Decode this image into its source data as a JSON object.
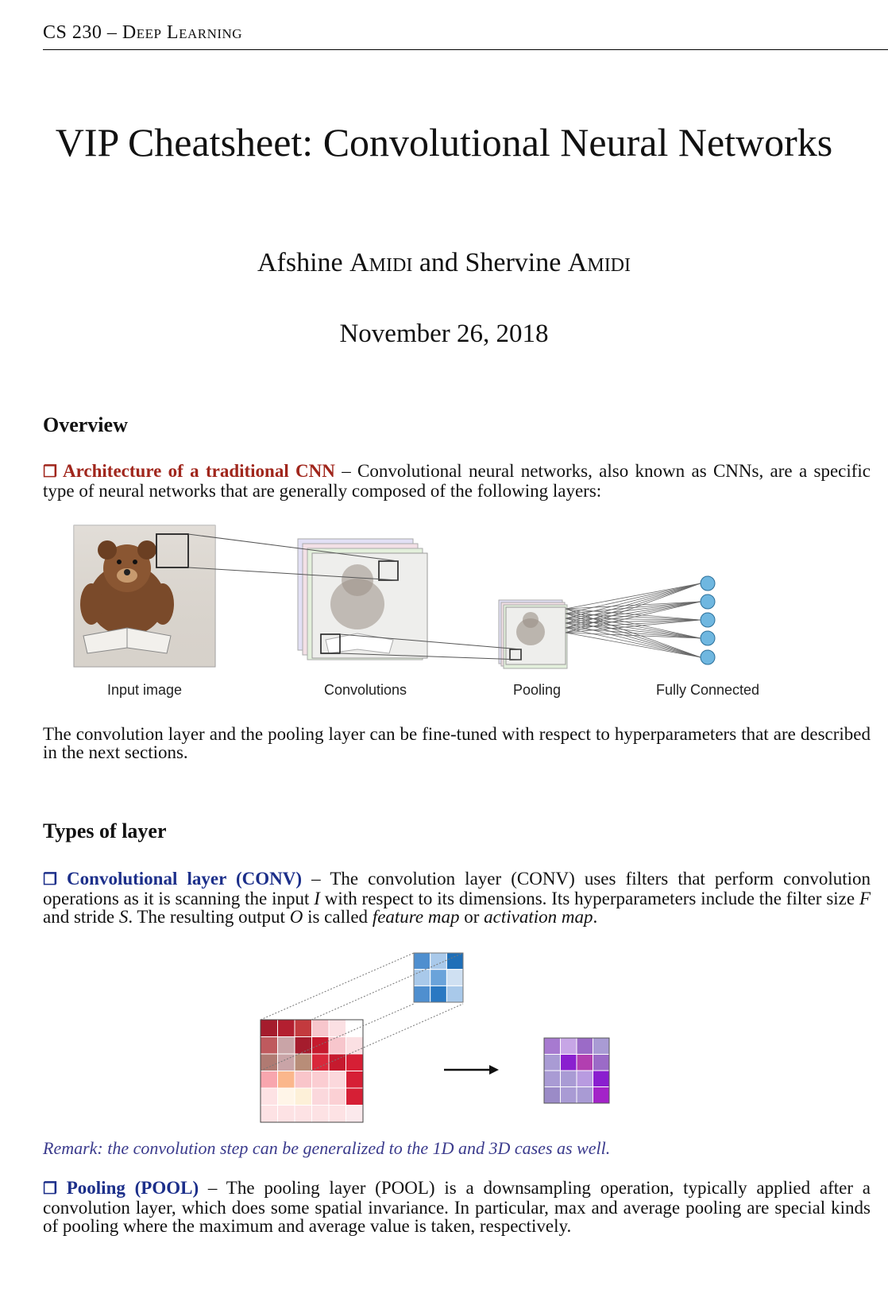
{
  "header": {
    "course": "CS 230 – Deep Learning"
  },
  "title": "VIP Cheatsheet: Convolutional Neural Networks",
  "authors": {
    "first": "Afshine",
    "first_last": "Amidi",
    "and": "and",
    "second": "Shervine",
    "second_last": "Amidi"
  },
  "date": "November 26, 2018",
  "overview": {
    "heading": "Overview",
    "arch_term": "Architecture of a traditional CNN",
    "arch_text": " – Convolutional neural networks, also known as CNNs, are a specific type of neural networks that are generally composed of the following layers:",
    "figure_labels": {
      "input": "Input image",
      "conv": "Convolutions",
      "pool": "Pooling",
      "fc": "Fully Connected"
    },
    "after_text": "The convolution layer and the pooling layer can be fine-tuned with respect to hyperparameters that are described in the next sections."
  },
  "types": {
    "heading": "Types of layer",
    "conv_term": "Convolutional layer (CONV)",
    "conv_text_1": " – The convolution layer (CONV) uses filters that perform convolution operations as it is scanning the input ",
    "conv_var_i": "I",
    "conv_text_2": " with respect to its dimensions. Its hyperparameters include the filter size ",
    "conv_var_f": "F",
    "conv_text_3": " and stride ",
    "conv_var_s": "S",
    "conv_text_4": ". The resulting output ",
    "conv_var_o": "O",
    "conv_text_5": " is called ",
    "conv_feature_map": "feature map",
    "conv_text_6": " or ",
    "conv_activation_map": "activation map",
    "conv_text_7": ".",
    "remark": "Remark: the convolution step can be generalized to the 1D and 3D cases as well.",
    "pool_term": "Pooling (POOL)",
    "pool_text": " – The pooling layer (POOL) is a downsampling operation, typically applied after a convolution layer, which does some spatial invariance. In particular, max and average pooling are special kinds of pooling where the maximum and average value is taken, respectively."
  },
  "colors": {
    "red_term": "#a0261c",
    "blue_term": "#1c2f8a",
    "remark": "#3a3a8c",
    "fc_node": "#6fb7e0"
  }
}
